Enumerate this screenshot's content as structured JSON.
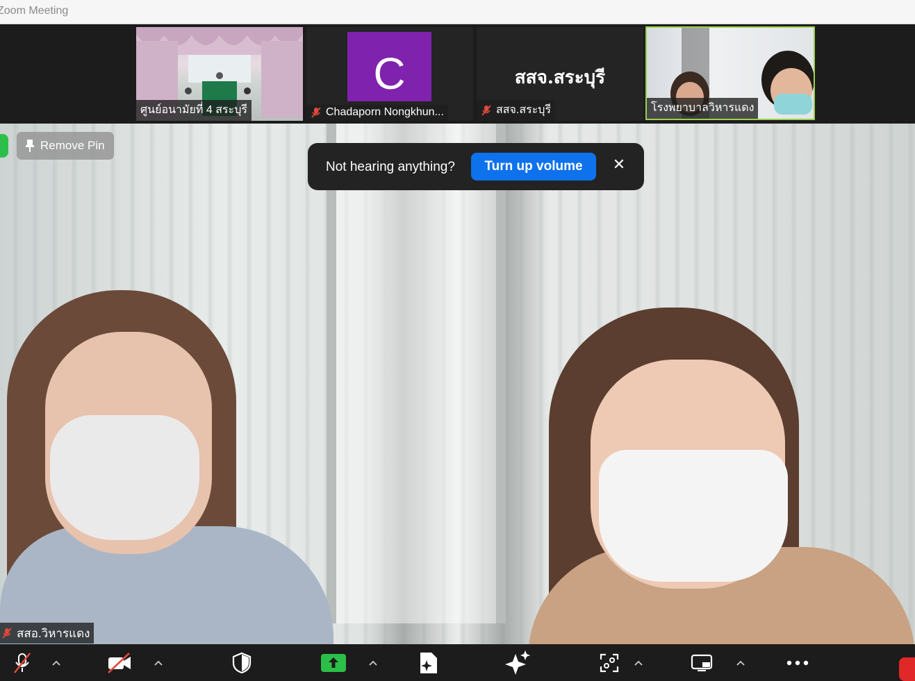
{
  "window": {
    "title": "Zoom Meeting"
  },
  "gallery": [
    {
      "name": "ศูนย์อนามัยที่ 4 สระบุรี",
      "muted": false
    },
    {
      "name": "Chadaporn Nongkhun...",
      "avatar_letter": "C",
      "avatar_color": "#7f22ad",
      "muted": true
    },
    {
      "name": "สสจ.สระบุรี",
      "display_text": "สสจ.สระบุรี",
      "muted": true
    },
    {
      "name": "โรงพยาบาลวิหารแดง",
      "active_speaker": true,
      "muted": false
    }
  ],
  "main_video": {
    "pin_label": "Remove Pin",
    "participant_name": "สสอ.วิหารแดง",
    "muted": true
  },
  "notice": {
    "message": "Not hearing anything?",
    "action_label": "Turn up volume"
  },
  "toolbar": {
    "items": [
      "mic-muted-icon",
      "video-off-icon",
      "security-icon",
      "share-screen-icon",
      "apps-icon",
      "ai-companion-icon",
      "focus-icon",
      "view-icon",
      "more-icon"
    ]
  },
  "colors": {
    "accent": "#0e72ed",
    "share": "#2bbf4a",
    "leave": "#e02828",
    "active_border": "#9bd24c"
  }
}
